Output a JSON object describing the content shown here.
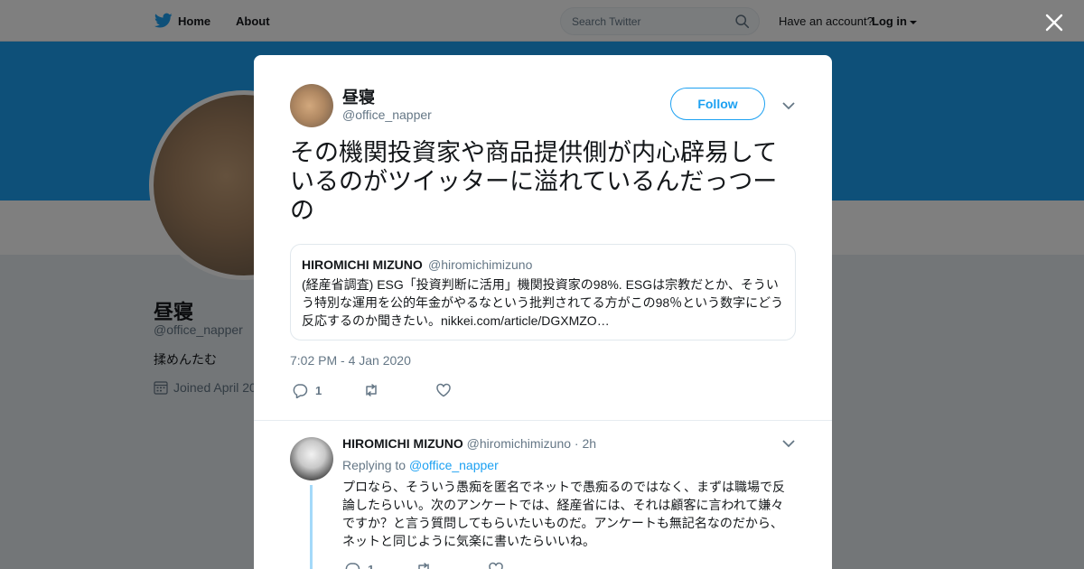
{
  "nav": {
    "home_label": "Home",
    "about_label": "About",
    "search_placeholder": "Search Twitter",
    "account_prompt": "Have an account?",
    "login_label": "Log in"
  },
  "profile": {
    "name": "昼寝",
    "handle": "@office_napper",
    "bio": "揉めんたむ",
    "joined": "Joined April 20"
  },
  "tweet": {
    "author_name": "昼寝",
    "author_handle": "@office_napper",
    "follow_label": "Follow",
    "text": "その機関投資家や商品提供側が内心辟易しているのがツイッターに溢れているんだっつーの",
    "quote": {
      "name": "HIROMICHI MIZUNO",
      "handle": "@hiromichimizuno",
      "text": "(経産省調査) ESG「投資判断に活用」機関投資家の98%.  ESGは宗教だとか、そういう特別な運用を公的年金がやるなという批判されてる方がこの98％という数字にどう反応するのか聞きたい。nikkei.com/article/DGXMZO…"
    },
    "timestamp": "7:02 PM - 4 Jan 2020",
    "reply_count": "1",
    "retweet_count": "",
    "like_count": ""
  },
  "reply": {
    "name": "HIROMICHI MIZUNO",
    "handle": "@hiromichimizuno",
    "time": "· 2h",
    "replying_prefix": "Replying to",
    "replying_to": "@office_napper",
    "text": "プロなら、そういう愚痴を匿名でネットで愚痴るのではなく、まずは職場で反論したらいい。次のアンケートでは、経産省には、それは顧客に言われて嫌々ですか？と言う質問してもらいたいものだ。アンケートも無記名なのだから、ネットと同じように気楽に書いたらいいね。",
    "reply_count": "1"
  },
  "colors": {
    "accent": "#1da1f2",
    "text": "#14171a",
    "secondary": "#657786",
    "banner": "#1da1f2"
  }
}
